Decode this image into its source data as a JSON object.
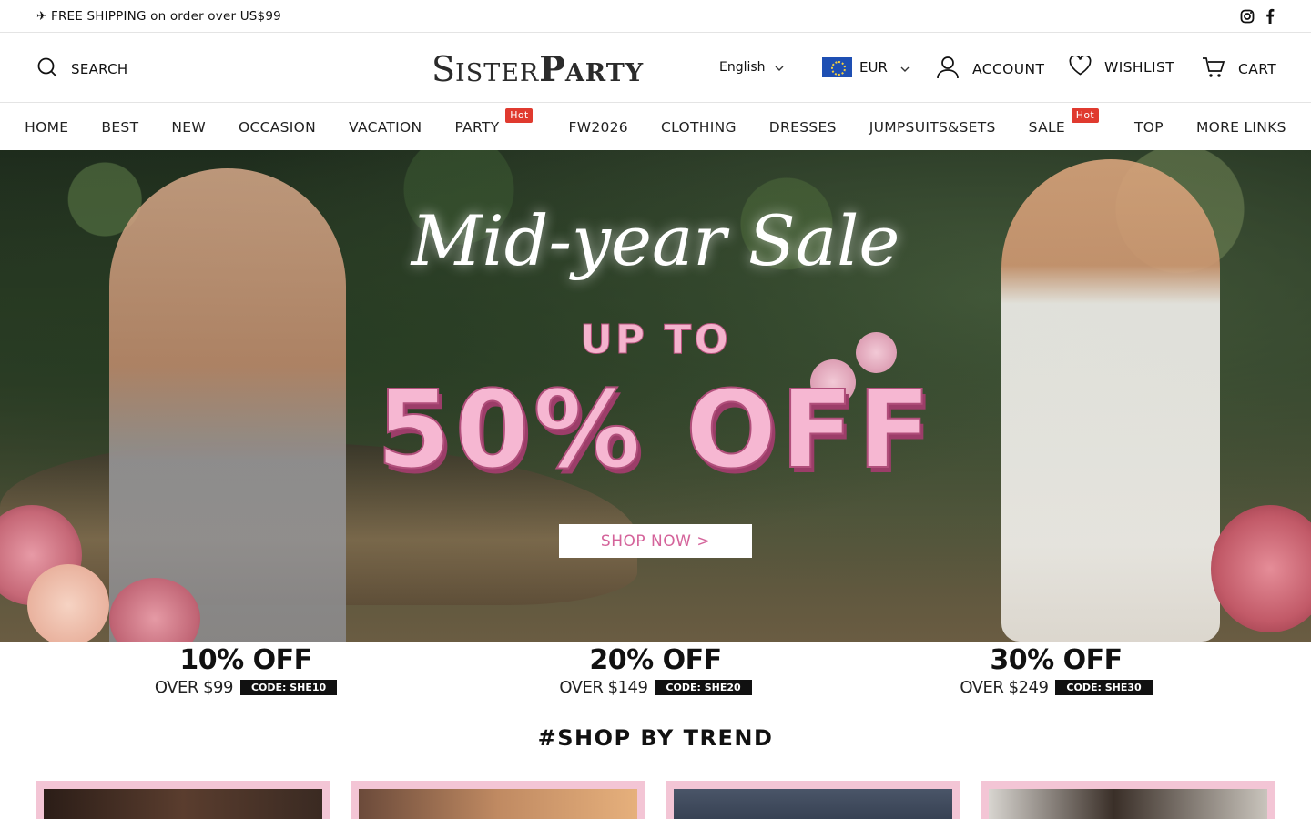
{
  "topbar": {
    "shipping_text": "✈ FREE SHIPPING on order over US$99",
    "social": [
      "instagram-icon",
      "facebook-icon"
    ]
  },
  "header": {
    "search_label": "SEARCH",
    "logo_text": "SisterParty",
    "language": "English",
    "currency": "EUR",
    "account_label": "ACCOUNT",
    "wishlist_label": "WISHLIST",
    "cart_label": "CART"
  },
  "nav": {
    "items": [
      "HOME",
      "BEST",
      "NEW",
      "OCCASION",
      "VACATION",
      "PARTY",
      "FW2026",
      "CLOTHING",
      "DRESSES",
      "JUMPSUITS&SETS",
      "SALE",
      "TOP",
      "MORE LINKS"
    ],
    "hot_badge": "Hot",
    "hot_items": [
      "PARTY",
      "SALE"
    ]
  },
  "hero": {
    "headline": "Mid-year Sale",
    "subhead": "UP TO",
    "discount": "50% OFF",
    "cta": "SHOP NOW >"
  },
  "promos": [
    {
      "discount": "10% OFF",
      "threshold": "OVER $99",
      "code": "CODE: SHE10"
    },
    {
      "discount": "20% OFF",
      "threshold": "OVER $149",
      "code": "CODE: SHE20"
    },
    {
      "discount": "30% OFF",
      "threshold": "OVER $249",
      "code": "CODE: SHE30"
    }
  ],
  "section": {
    "trend_title": "#SHOP BY TREND"
  },
  "colors": {
    "accent_pink": "#f3c5d5",
    "hot_badge": "#e03a2f",
    "cta_text": "#d4639a"
  }
}
